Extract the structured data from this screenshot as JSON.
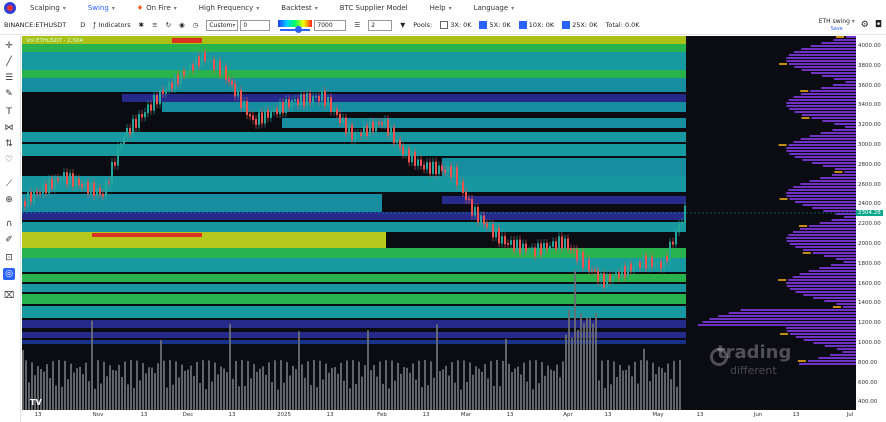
{
  "nav": [
    {
      "label": "Scalping",
      "active": false
    },
    {
      "label": "Swing",
      "active": true
    },
    {
      "label": "On Fire",
      "active": false
    },
    {
      "label": "High Frequency",
      "active": false
    },
    {
      "label": "Backtest",
      "active": false
    },
    {
      "label": "BTC Supplier Model",
      "active": false
    },
    {
      "label": "Help",
      "active": false
    },
    {
      "label": "Language",
      "active": false
    }
  ],
  "toolbar": {
    "symbol": "BINANCE:ETHUSDT",
    "interval": "D",
    "indicators": "Indicators",
    "mode_value": "Custom",
    "mode_input": "0",
    "range_value": "7000",
    "step_value": "2",
    "pools_label": "Pools:",
    "pools": [
      {
        "label": "3X: 0K",
        "checked": false
      },
      {
        "label": "5X: 0K",
        "checked": true
      },
      {
        "label": "10X: 0K",
        "checked": true
      },
      {
        "label": "25X: 0K",
        "checked": true
      }
    ],
    "total": "Total: 0.0K",
    "profile_name": "ETH swing",
    "profile_sub": "Save"
  },
  "chart": {
    "legend": "Vol  ETHUSDT  ·  2,504",
    "current_price": "2304.28",
    "watermark_main": "trading",
    "watermark_sub": "different",
    "tv_logo": "TV"
  },
  "yaxis": [
    "4000.00",
    "3800.00",
    "3600.00",
    "3400.00",
    "3200.00",
    "3000.00",
    "2800.00",
    "2600.00",
    "2400.00",
    "2200.00",
    "2000.00",
    "1800.00",
    "1600.00",
    "1400.00",
    "1200.00",
    "1000.00",
    "800.00",
    "600.00",
    "400.00"
  ],
  "xaxis": [
    "13",
    "Nov",
    "13",
    "Dec",
    "13",
    "2025",
    "13",
    "Feb",
    "13",
    "Mar",
    "13",
    "Apr",
    "13",
    "May",
    "13",
    "Jun",
    "13",
    "Jul"
  ],
  "colors": {
    "bg": "#0b0b12",
    "accent": "#2962ff",
    "up": "#26a69a",
    "down": "#ef5350"
  },
  "chart_data": {
    "type": "candlestick",
    "symbol": "BINANCE:ETHUSDT",
    "interval": "D",
    "ylim": [
      400,
      4100
    ],
    "current_price": 2304.28,
    "approx_monthly_closes": [
      {
        "month": "Oct",
        "close": 2500
      },
      {
        "month": "Nov",
        "close": 3600
      },
      {
        "month": "Dec",
        "close": 3350
      },
      {
        "month": "Jan",
        "close": 3300
      },
      {
        "month": "Feb",
        "close": 2230
      },
      {
        "month": "Mar",
        "close": 1820
      },
      {
        "month": "Apr",
        "close": 1795
      },
      {
        "month": "May",
        "close": 2304
      }
    ]
  }
}
